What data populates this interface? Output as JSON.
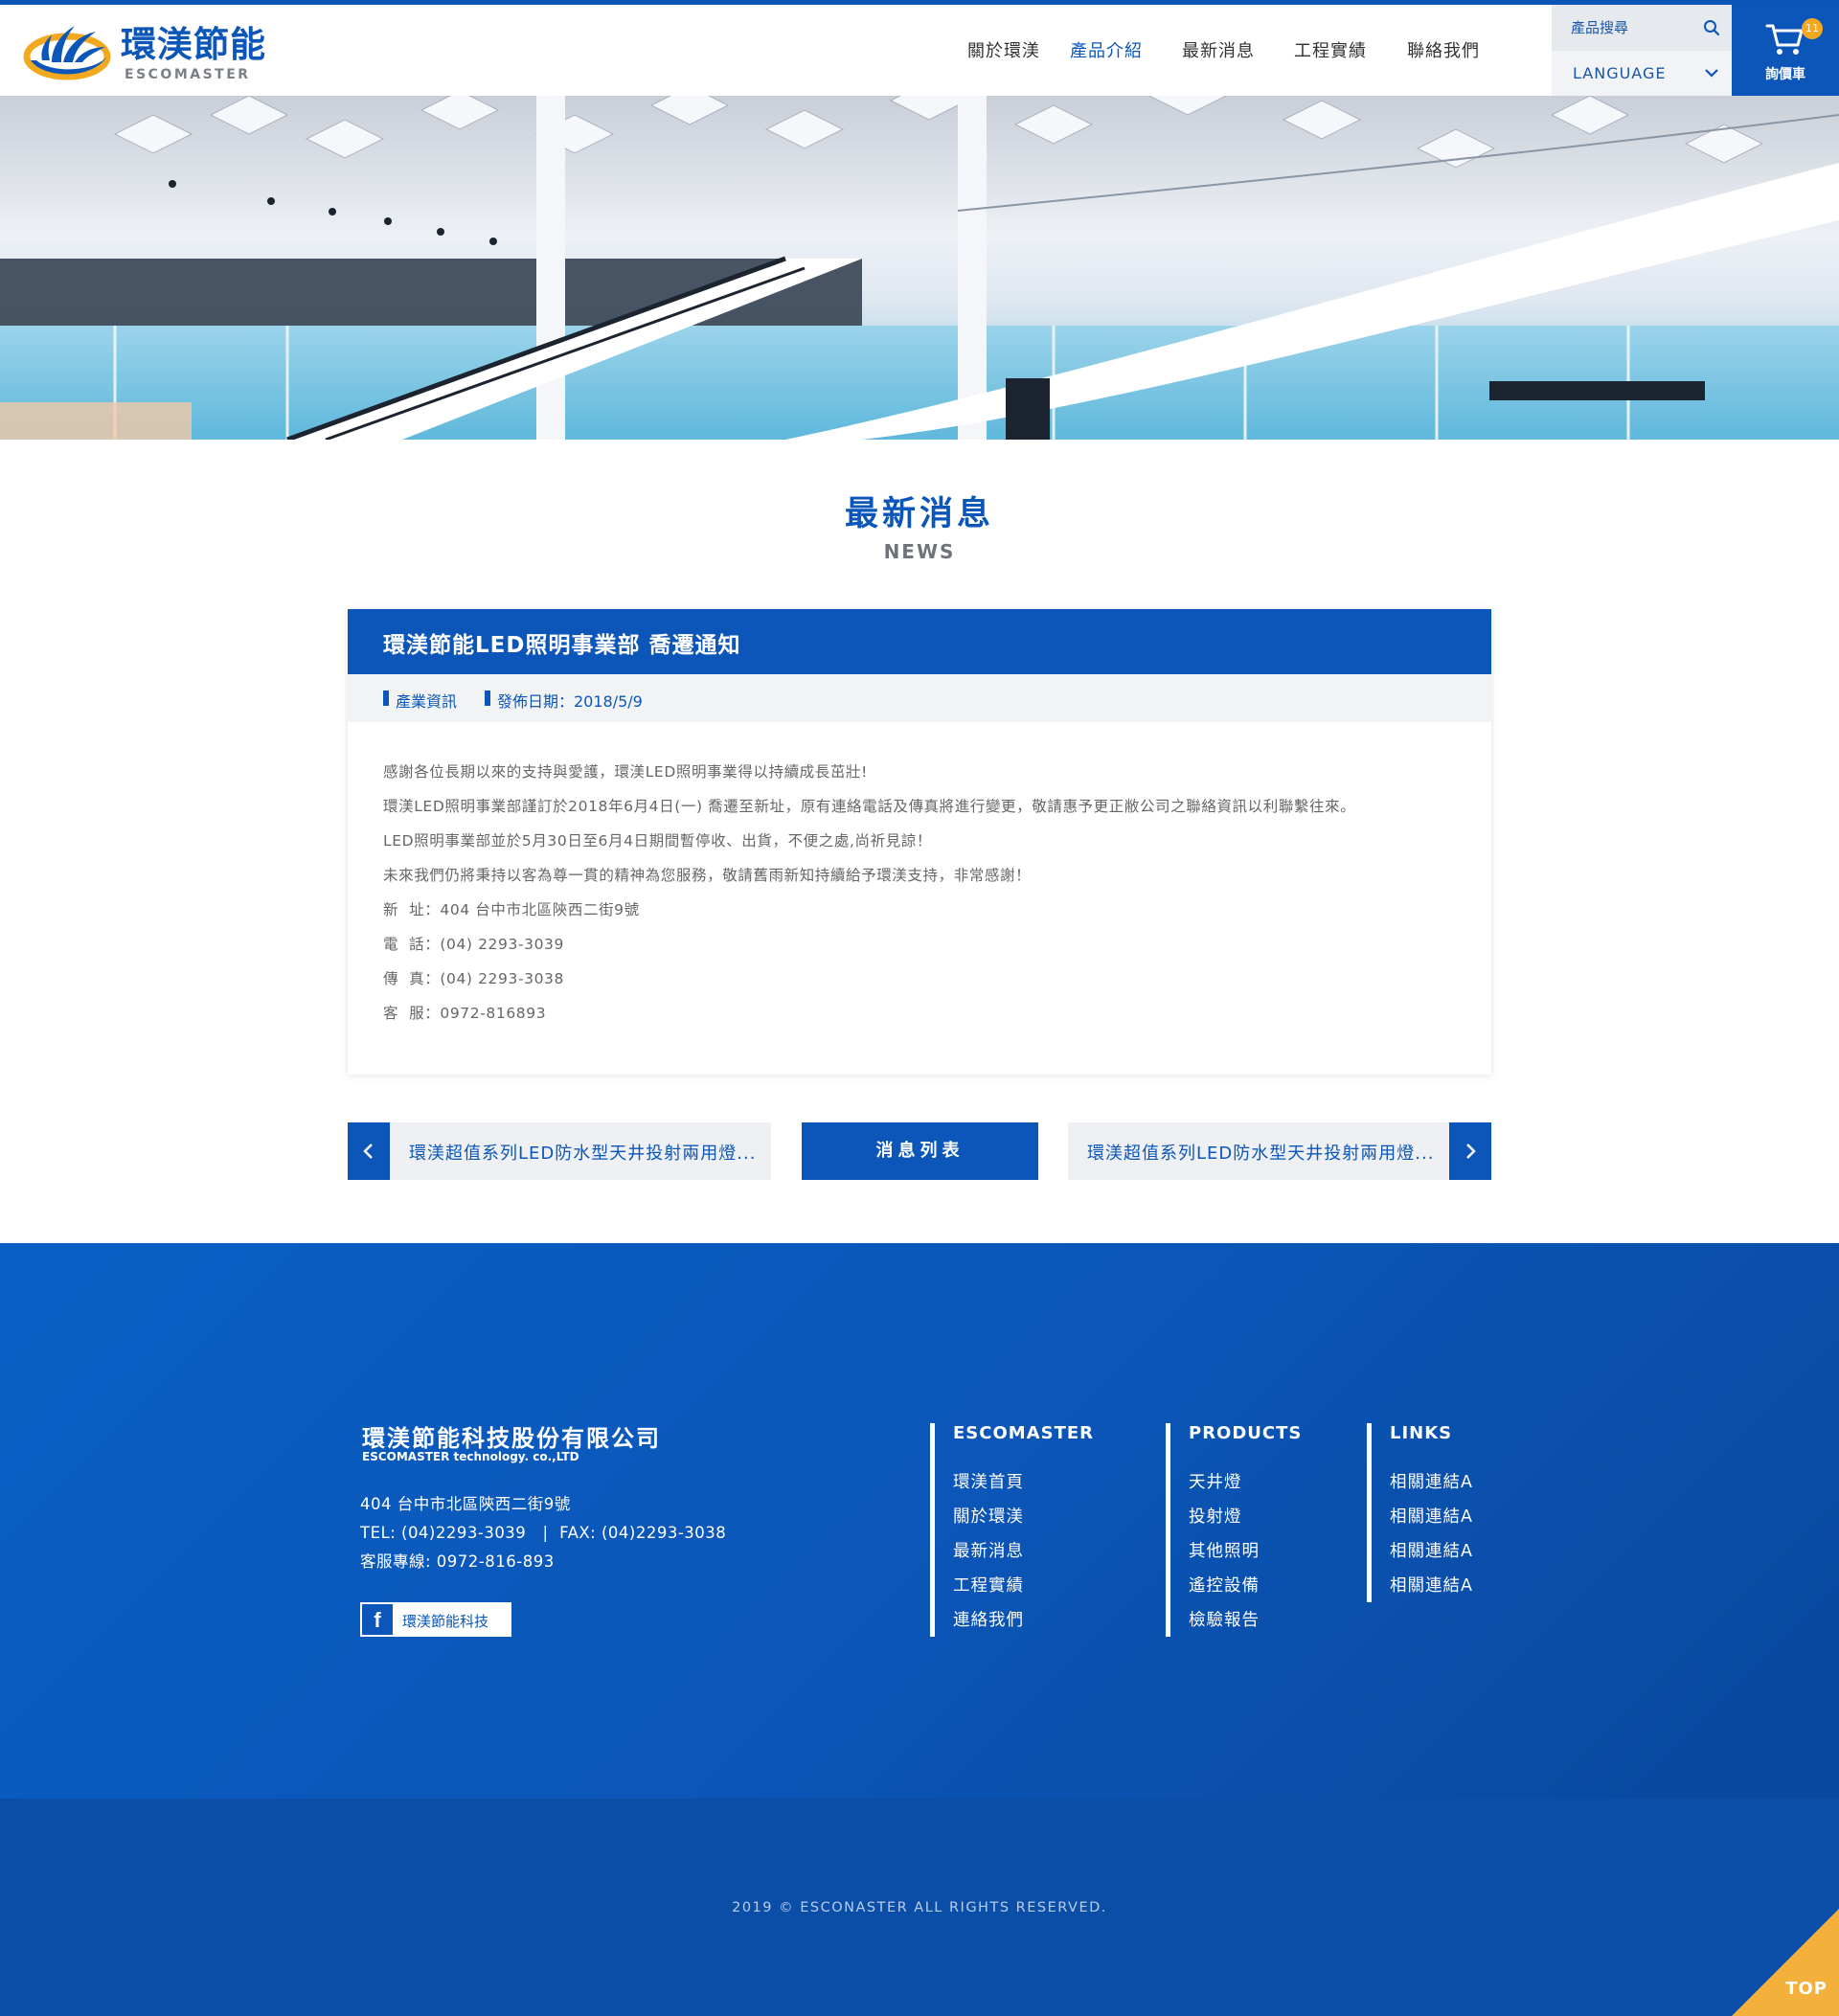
{
  "header": {
    "logo_title": "環渼節能",
    "logo_sub": "ESCOMASTER",
    "nav": [
      "關於環渼",
      "產品介紹",
      "最新消息",
      "工程實績",
      "聯絡我們"
    ],
    "search_placeholder": "產品搜尋",
    "language_label": "LANGUAGE",
    "cart_label": "詢價車",
    "cart_count": "11",
    "icons": [
      "search-icon",
      "chevron-down-icon",
      "cart-icon"
    ]
  },
  "page": {
    "title": "最新消息",
    "subtitle": "NEWS"
  },
  "article": {
    "title": "環渼節能LED照明事業部 喬遷通知",
    "category": "產業資訊",
    "date": "發佈日期：2018/5/9",
    "paragraphs": [
      "感謝各位長期以來的支持與愛護，環渼LED照明事業得以持續成長茁壯!",
      "環渼LED照明事業部謹訂於2018年6月4日(一) 喬遷至新址，原有連絡電話及傳真將進行變更，敬請惠予更正敝公司之聯絡資訊以利聯繫往來。",
      "LED照明事業部並於5月30日至6月4日期間暫停收、出貨，不便之處,尚祈見諒！",
      "未來我們仍將秉持以客為尊一貫的精神為您服務，敬請舊雨新知持續給予環渼支持，非常感謝！",
      "新  址：404 台中市北區陝西二街9號",
      "電  話：(04) 2293-3039",
      "傳  真：(04) 2293-3038",
      "客  服：0972-816893"
    ]
  },
  "pager": {
    "prev_text": "環渼超值系列LED防水型天井投射兩用燈...",
    "list_label": "消息列表",
    "next_text": "環渼超值系列LED防水型天井投射兩用燈..."
  },
  "footer": {
    "company": "環渼節能科技股份有限公司",
    "company_en": "ESCOMASTER technology. co.,LTD",
    "address": "404 台中市北區陝西二街9號",
    "tel_fax": "TEL: (04)2293-3039   |  FAX: (04)2293-3038",
    "service": "客服專線: 0972-816-893",
    "fb_label": "環渼節能科技",
    "columns": [
      {
        "title": "ESCOMASTER",
        "items": [
          "環渼首頁",
          "關於環渼",
          "最新消息",
          "工程實績",
          "連絡我們"
        ]
      },
      {
        "title": "PRODUCTS",
        "items": [
          "天井燈",
          "投射燈",
          "其他照明",
          "遙控設備",
          "檢驗報告"
        ]
      },
      {
        "title": "LINKS",
        "items": [
          "相關連結A",
          "相關連結A",
          "相關連結A",
          "相關連結A"
        ]
      }
    ],
    "copyright": "2019 © ESCONASTER ALL RIGHTS RESERVED.",
    "top_label": "TOP"
  },
  "colors": {
    "brand_blue": "#0b56b8",
    "accent_yellow": "#f3a91f"
  }
}
